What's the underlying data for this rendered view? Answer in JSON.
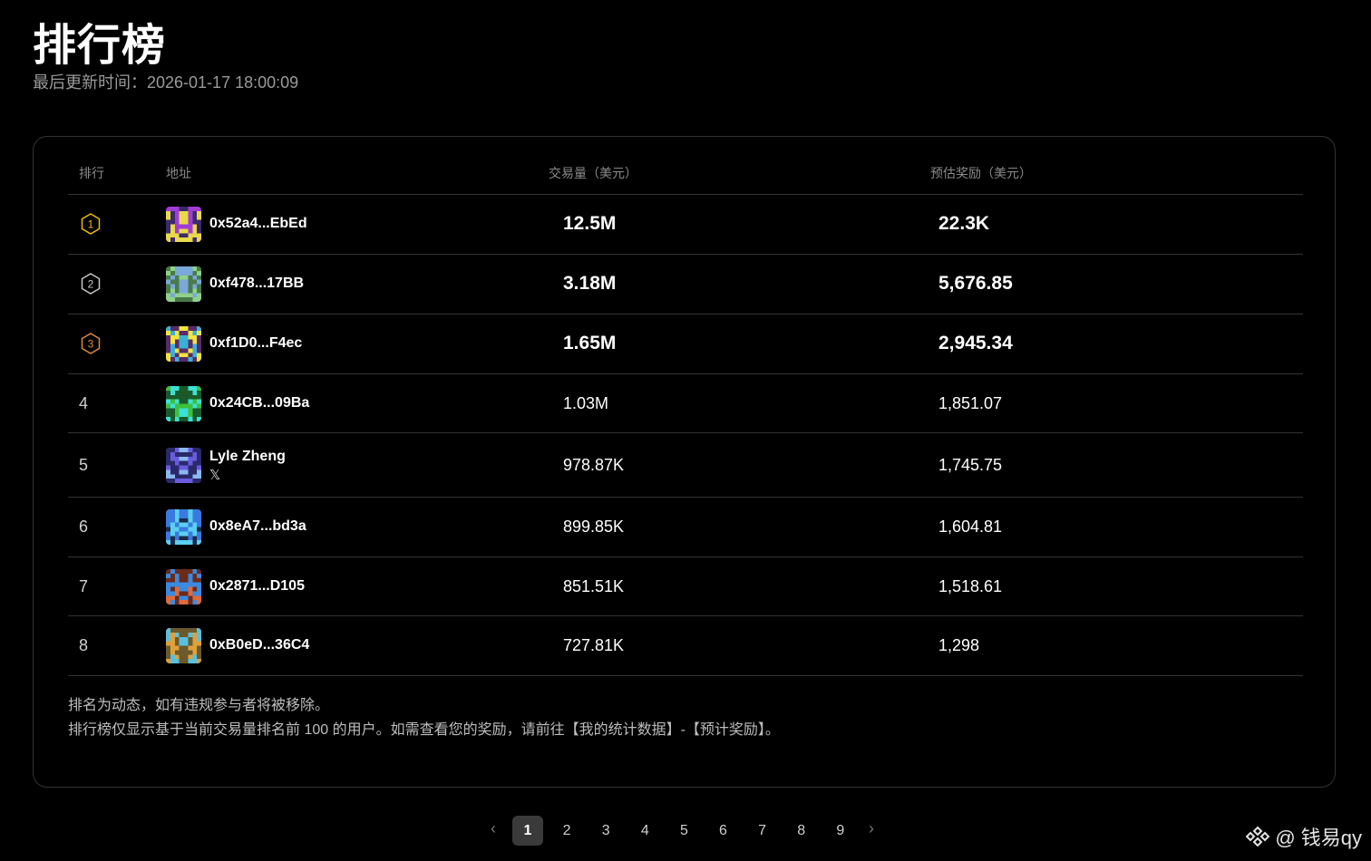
{
  "header": {
    "title": "排行榜",
    "updated": "最后更新时间：2026-01-17 18:00:09"
  },
  "table": {
    "columns": [
      "排行",
      "地址",
      "交易量（美元）",
      "预估奖励（美元）"
    ],
    "rows": [
      {
        "rank": "1",
        "address": "0x52a4...EbEd",
        "volume": "12.5M",
        "reward": "22.3K",
        "badge_color": "#f0b90b",
        "avatar": [
          "#a23bd6",
          "#e8d94a",
          "#3b2a6b"
        ]
      },
      {
        "rank": "2",
        "address": "0xf478...17BB",
        "volume": "3.18M",
        "reward": "5,676.85",
        "badge_color": "#c8c8c8",
        "avatar": [
          "#8fd18a",
          "#7aa8d8",
          "#4a7a4a"
        ]
      },
      {
        "rank": "3",
        "address": "0xf1D0...F4ec",
        "volume": "1.65M",
        "reward": "2,945.34",
        "badge_color": "#e08a3c",
        "avatar": [
          "#f2e53a",
          "#3bb0d6",
          "#5a2a6b"
        ]
      },
      {
        "rank": "4",
        "address": "0x24CB...09Ba",
        "volume": "1.03M",
        "reward": "1,851.07",
        "badge_color": "",
        "avatar": [
          "#3fc03a",
          "#3be0d6",
          "#1a5a2a"
        ]
      },
      {
        "rank": "5",
        "address": "Lyle Zheng",
        "volume": "978.87K",
        "reward": "1,745.75",
        "badge_color": "",
        "avatar": [
          "#6a5ae0",
          "#8ab8f0",
          "#2a2a6b"
        ],
        "social": "𝕏"
      },
      {
        "rank": "6",
        "address": "0x8eA7...bd3a",
        "volume": "899.85K",
        "reward": "1,604.81",
        "badge_color": "",
        "avatar": [
          "#3a7ae0",
          "#5ad0f0",
          "#1a2a4b"
        ]
      },
      {
        "rank": "7",
        "address": "0x2871...D105",
        "volume": "851.51K",
        "reward": "1,518.61",
        "badge_color": "",
        "avatar": [
          "#e06a3a",
          "#3a8ae0",
          "#6b2a1a"
        ]
      },
      {
        "rank": "8",
        "address": "0xB0eD...36C4",
        "volume": "727.81K",
        "reward": "1,298",
        "badge_color": "",
        "avatar": [
          "#e0a03a",
          "#5ac0e0",
          "#6b5a2a"
        ]
      }
    ]
  },
  "notes": [
    "排名为动态，如有违规参与者将被移除。",
    "排行榜仅显示基于当前交易量排名前 100 的用户。如需查看您的奖励，请前往【我的统计数据】-【预计奖励】。"
  ],
  "pagination": {
    "prev": "‹",
    "next": "›",
    "pages": [
      "1",
      "2",
      "3",
      "4",
      "5",
      "6",
      "7",
      "8",
      "9"
    ],
    "current": "1"
  },
  "watermark": {
    "icon": "binance-logo-icon",
    "text": "@ 钱易qy"
  }
}
